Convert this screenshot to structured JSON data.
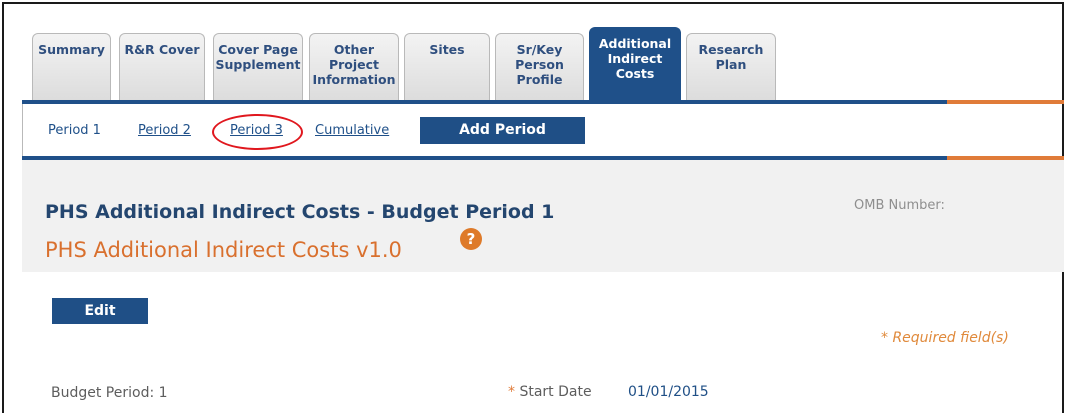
{
  "tabs": [
    {
      "label": "Summary",
      "active": false
    },
    {
      "label": "R&R Cover",
      "active": false
    },
    {
      "label": "Cover Page\nSupplement",
      "active": false
    },
    {
      "label": "Other\nProject\nInformation",
      "active": false
    },
    {
      "label": "Sites",
      "active": false
    },
    {
      "label": "Sr/Key\nPerson\nProfile",
      "active": false
    },
    {
      "label": "Additional\nIndirect\nCosts",
      "active": true
    },
    {
      "label": "Research\nPlan",
      "active": false
    }
  ],
  "periods": {
    "p1": "Period 1",
    "p2": "Period 2",
    "p3": "Period 3",
    "cumulative": "Cumulative"
  },
  "add_period_label": "Add Period",
  "header": {
    "title": "PHS Additional Indirect Costs - Budget Period 1",
    "form_name": "PHS Additional Indirect Costs v1.0",
    "help_icon": "?",
    "omb_label": "OMB Number:"
  },
  "edit_label": "Edit",
  "required_note": "* Required field(s)",
  "budget_period_label": "Budget Period: 1",
  "start_date": {
    "required_marker": "*",
    "label": "Start Date",
    "value": "01/01/2015"
  },
  "colors": {
    "brand_blue": "#1f5089",
    "accent_orange": "#e07b39",
    "highlight_red": "#e0171e"
  }
}
